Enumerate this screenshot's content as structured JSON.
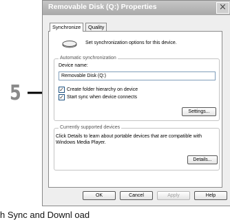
{
  "step_number": "5",
  "bottom_caption": "h  Sync  and  Downl  oad",
  "window": {
    "title": "Removable Disk (Q:) Properties",
    "close_glyph": "×",
    "tabs": [
      "Synchronize",
      "Quality"
    ],
    "active_tab": "Synchronize",
    "intro_text": "Set synchronization options for this device.",
    "auto_sync": {
      "group_title": "Automatic synchronization",
      "device_name_label": "Device name:",
      "device_name_value": "Removable Disk (Q:)",
      "create_folder_label": "Create folder hierarchy on device",
      "create_folder_checked": true,
      "start_sync_label": "Start sync when device connects",
      "start_sync_checked": true,
      "settings_button": "Settings..."
    },
    "supported": {
      "group_title": "Currently supported devices",
      "description_line1": "Click Details to learn about portable devices that are compatible with",
      "description_line2": "Windows Media Player.",
      "details_button": "Details..."
    },
    "buttons": {
      "ok": "OK",
      "cancel": "Cancel",
      "apply": "Apply",
      "help": "Help"
    }
  }
}
